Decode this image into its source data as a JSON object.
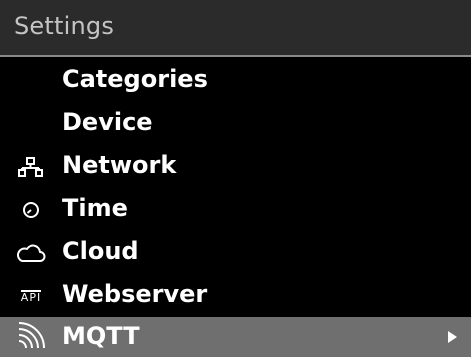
{
  "header": {
    "title": "Settings"
  },
  "menu": {
    "items": [
      {
        "label": "Categories",
        "icon": ""
      },
      {
        "label": "Device",
        "icon": ""
      },
      {
        "label": "Network",
        "icon": "network-icon"
      },
      {
        "label": "Time",
        "icon": "clock-icon"
      },
      {
        "label": "Cloud",
        "icon": "cloud-icon"
      },
      {
        "label": "Webserver",
        "icon": "api-icon",
        "icon_text": "API"
      },
      {
        "label": "MQTT",
        "icon": "wifi-signal-icon",
        "selected": true
      }
    ]
  },
  "colors": {
    "background": "#000000",
    "header_bg": "#2b2b2b",
    "header_text": "#c4c4c4",
    "selected_bg": "#6f6f6f",
    "text": "#ffffff"
  }
}
